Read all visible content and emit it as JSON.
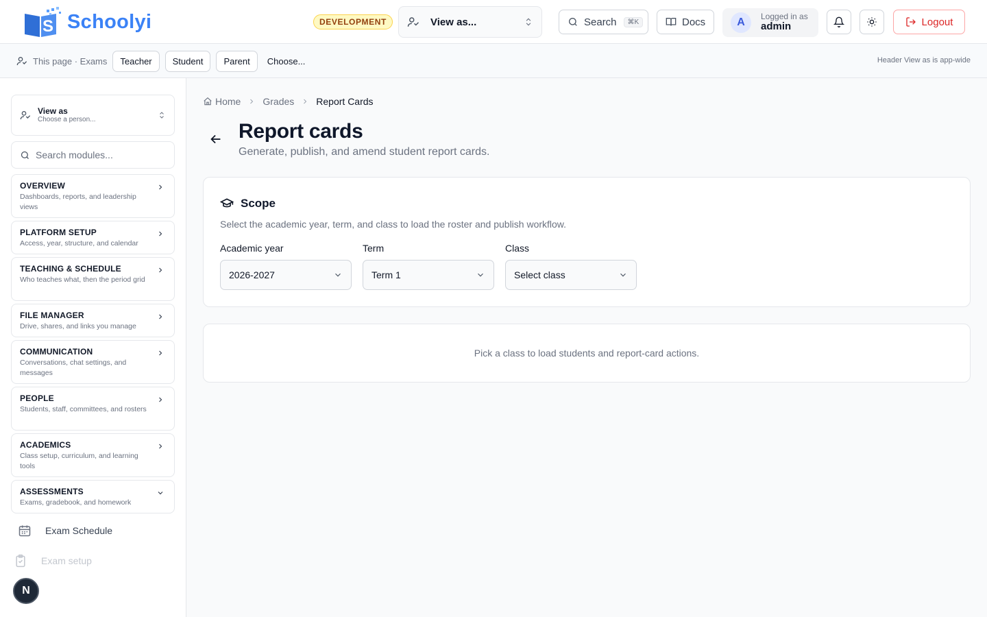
{
  "header": {
    "logo_text": "Schoolyi",
    "env_badge": "DEVELOPMENT",
    "view_as_label": "View as...",
    "search_label": "Search",
    "search_shortcut": "⌘K",
    "docs_label": "Docs",
    "user": {
      "initial": "A",
      "logged_in_label": "Logged in as",
      "name": "admin"
    },
    "logout_label": "Logout"
  },
  "subbar": {
    "context": "This page · Exams",
    "roles": [
      "Teacher",
      "Student",
      "Parent"
    ],
    "choose_label": "Choose...",
    "note": "Header View as is app-wide"
  },
  "sidebar": {
    "view_as": {
      "title": "View as",
      "subtitle": "Choose a person..."
    },
    "search_placeholder": "Search modules...",
    "modules": [
      {
        "title": "OVERVIEW",
        "desc": "Dashboards, reports, and leadership views",
        "expanded": false
      },
      {
        "title": "PLATFORM SETUP",
        "desc": "Access, year, structure, and calendar",
        "expanded": false
      },
      {
        "title": "TEACHING & SCHEDULE",
        "desc": "Who teaches what, then the period grid",
        "expanded": false
      },
      {
        "title": "FILE MANAGER",
        "desc": "Drive, shares, and links you manage",
        "expanded": false
      },
      {
        "title": "COMMUNICATION",
        "desc": "Conversations, chat settings, and messages",
        "expanded": false
      },
      {
        "title": "PEOPLE",
        "desc": "Students, staff, committees, and rosters",
        "expanded": false
      },
      {
        "title": "ACADEMICS",
        "desc": "Class setup, curriculum, and learning tools",
        "expanded": false
      },
      {
        "title": "ASSESSMENTS",
        "desc": "Exams, gradebook, and homework",
        "expanded": true
      }
    ],
    "sub_items": [
      "Exam Schedule",
      "Exam setup"
    ],
    "fab_label": "N"
  },
  "breadcrumb": {
    "home": "Home",
    "parent": "Grades",
    "current": "Report Cards"
  },
  "page": {
    "title": "Report cards",
    "subtitle": "Generate, publish, and amend student report cards."
  },
  "scope": {
    "title": "Scope",
    "description": "Select the academic year, term, and class to load the roster and publish workflow.",
    "fields": [
      {
        "label": "Academic year",
        "value": "2026-2027"
      },
      {
        "label": "Term",
        "value": "Term 1"
      },
      {
        "label": "Class",
        "value": "Select class"
      }
    ]
  },
  "empty_state": "Pick a class to load students and report-card actions.",
  "colors": {
    "brand": "#3b82f6",
    "danger": "#dc2626",
    "badge_bg": "#fef9c3"
  }
}
